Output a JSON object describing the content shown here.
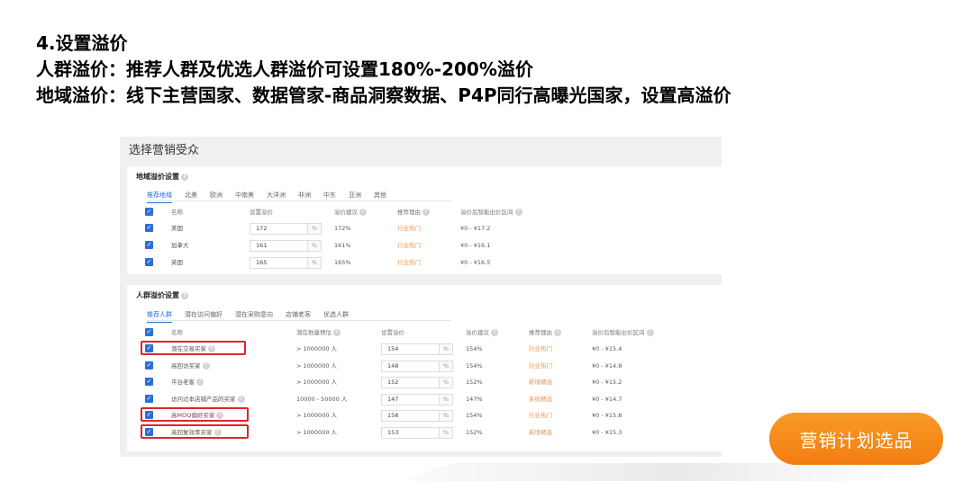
{
  "heading": {
    "line1": "4.设置溢价",
    "line2": "人群溢价：推荐人群及优选人群溢价可设置180%-200%溢价",
    "line3": "地域溢价：线下主营国家、数据管家-商品洞察数据、P4P同行高曝光国家，设置高溢价"
  },
  "panel": {
    "title": "选择营销受众"
  },
  "region": {
    "title": "地域溢价设置",
    "tabs": [
      "推荐地域",
      "北美",
      "欧洲",
      "中南美",
      "大洋洲",
      "非洲",
      "中东",
      "亚洲",
      "其他"
    ],
    "headers": {
      "name": "名称",
      "set": "设置溢价",
      "suggest": "溢价建议",
      "reason": "推荐理由",
      "range": "溢价后智能出价区间"
    },
    "rows": [
      {
        "name": "美国",
        "value": "172",
        "unit": "%",
        "suggest": "172%",
        "reason": "行业热门",
        "range": "¥0 - ¥17.2"
      },
      {
        "name": "加拿大",
        "value": "161",
        "unit": "%",
        "suggest": "161%",
        "reason": "行业热门",
        "range": "¥0 - ¥16.1"
      },
      {
        "name": "英国",
        "value": "165",
        "unit": "%",
        "suggest": "165%",
        "reason": "行业热门",
        "range": "¥0 - ¥16.5"
      }
    ]
  },
  "crowd": {
    "title": "人群溢价设置",
    "tabs": [
      "推荐人群",
      "潜在访问偏好",
      "潜在采购意向",
      "店铺老客",
      "优选人群"
    ],
    "headers": {
      "name": "名称",
      "count": "潜在数量预估",
      "set": "设置溢价",
      "suggest": "溢价建议",
      "reason": "推荐理由",
      "range": "溢价后智能出价区间"
    },
    "rows": [
      {
        "name": "潜在交易买家",
        "count": "> 1000000 人",
        "value": "154",
        "unit": "%",
        "suggest": "154%",
        "reason": "行业热门",
        "range": "¥0 - ¥15.4"
      },
      {
        "name": "高回访买家",
        "count": "> 1000000 人",
        "value": "148",
        "unit": "%",
        "suggest": "154%",
        "reason": "行业热门",
        "range": "¥0 - ¥14.8"
      },
      {
        "name": "平台老客",
        "count": "> 1000000 人",
        "value": "152",
        "unit": "%",
        "suggest": "152%",
        "reason": "新增精选",
        "range": "¥0 - ¥15.2"
      },
      {
        "name": "访问过本店铺产品的买家",
        "count": "10000 - 50000 人",
        "value": "147",
        "unit": "%",
        "suggest": "147%",
        "reason": "系统精选",
        "range": "¥0 - ¥14.7"
      },
      {
        "name": "高MOQ偏好买家",
        "count": "> 1000000 人",
        "value": "158",
        "unit": "%",
        "suggest": "154%",
        "reason": "行业热门",
        "range": "¥0 - ¥15.8"
      },
      {
        "name": "高回复效率买家",
        "count": "> 1000000 人",
        "value": "153",
        "unit": "%",
        "suggest": "152%",
        "reason": "新增精选",
        "range": "¥0 - ¥15.3"
      }
    ]
  },
  "cta": {
    "label": "营销计划选品"
  },
  "colors": {
    "accent": "#2b6fd6",
    "orange": "#f0944b",
    "highlight": "#e0242b",
    "cta": "#f37d12"
  },
  "icons": {
    "checkbox": "check-icon",
    "help": "help-icon"
  }
}
